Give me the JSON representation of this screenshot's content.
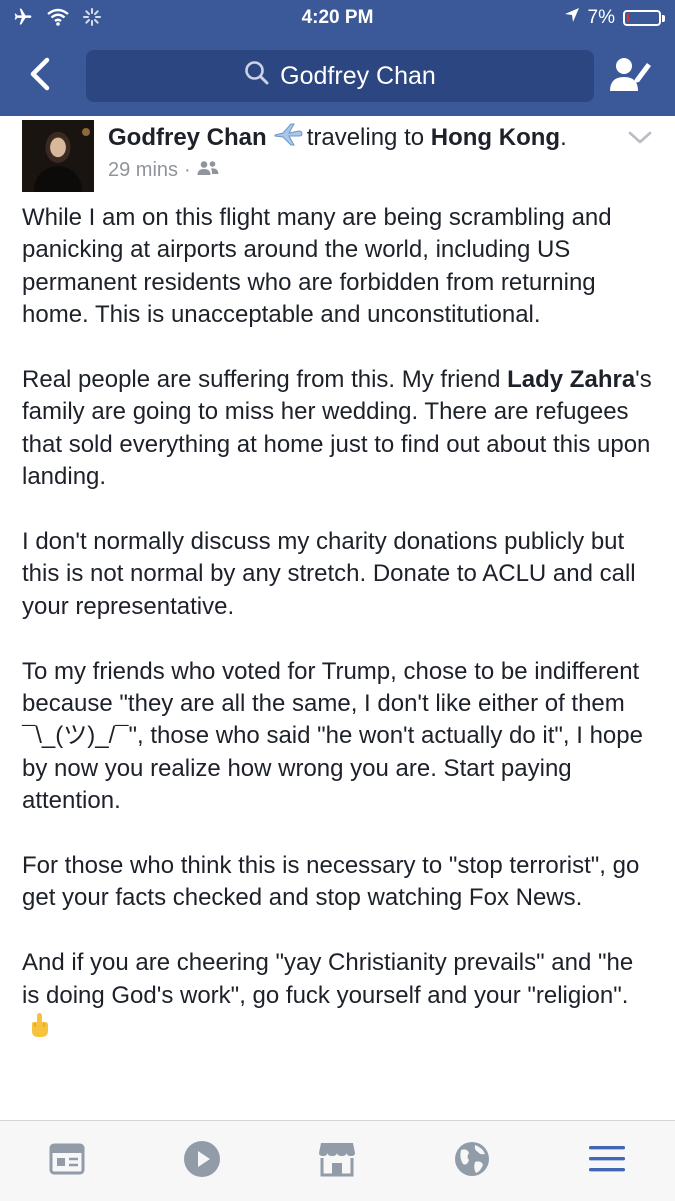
{
  "status_bar": {
    "time": "4:20 PM",
    "battery_percent": "7%",
    "battery_level": 0.07,
    "icons": [
      "airplane-icon",
      "wifi-icon",
      "activity-spinner-icon",
      "location-arrow-icon",
      "battery-icon"
    ]
  },
  "nav": {
    "search_value": "Godfrey Chan",
    "back_icon": "chevron-left-icon",
    "search_icon": "search-icon",
    "profile_icon": "edit-profile-icon"
  },
  "post": {
    "author": "Godfrey Chan",
    "activity_text": "traveling to",
    "activity_icon": "airplane-icon",
    "destination": "Hong Kong",
    "destination_suffix": ".",
    "timestamp": "29 mins",
    "separator": "·",
    "audience_icon": "friends-icon",
    "menu_icon": "chevron-down-icon",
    "paragraphs": {
      "p1": "While I am on this flight many are being scrambling and panicking at airports around the world, including US permanent residents who are forbidden from returning home. This is unacceptable and unconstitutional.",
      "p2_before": "Real people are suffering from this. My friend ",
      "p2_bold": "Lady Zahra",
      "p2_after": "'s family are going to miss her wedding. There are refugees that sold everything at home just to find out about this upon landing.",
      "p3": "I don't normally discuss my charity donations publicly but this is not normal by any stretch. Donate to ACLU and call your representative.",
      "p4": "To my friends who voted for Trump, chose to be indifferent because \"they are all the same, I don't like either of them ¯\\_(ツ)_/¯\", those who said \"he won't actually do it\", I hope by now you realize how wrong you are. Start paying attention.",
      "p5": "For those who think this is necessary to \"stop terrorist\", go get your facts checked and stop watching Fox News.",
      "p6": "And if you are cheering \"yay Christianity prevails\" and \"he is doing God's work\", go fuck yourself and your \"religion\"."
    },
    "emoji_icon": "middle-finger-emoji-icon"
  },
  "tabbar": {
    "tabs": [
      "news-feed-icon",
      "video-icon",
      "marketplace-icon",
      "notifications-globe-icon",
      "menu-icon"
    ],
    "active_tab": "menu-icon",
    "colors": {
      "inactive": "#929ba8",
      "active": "#4267b2"
    }
  },
  "colors": {
    "brand_blue": "#3b5998",
    "search_field": "#2b4680",
    "text": "#1d2129",
    "meta_text": "#90949c"
  }
}
